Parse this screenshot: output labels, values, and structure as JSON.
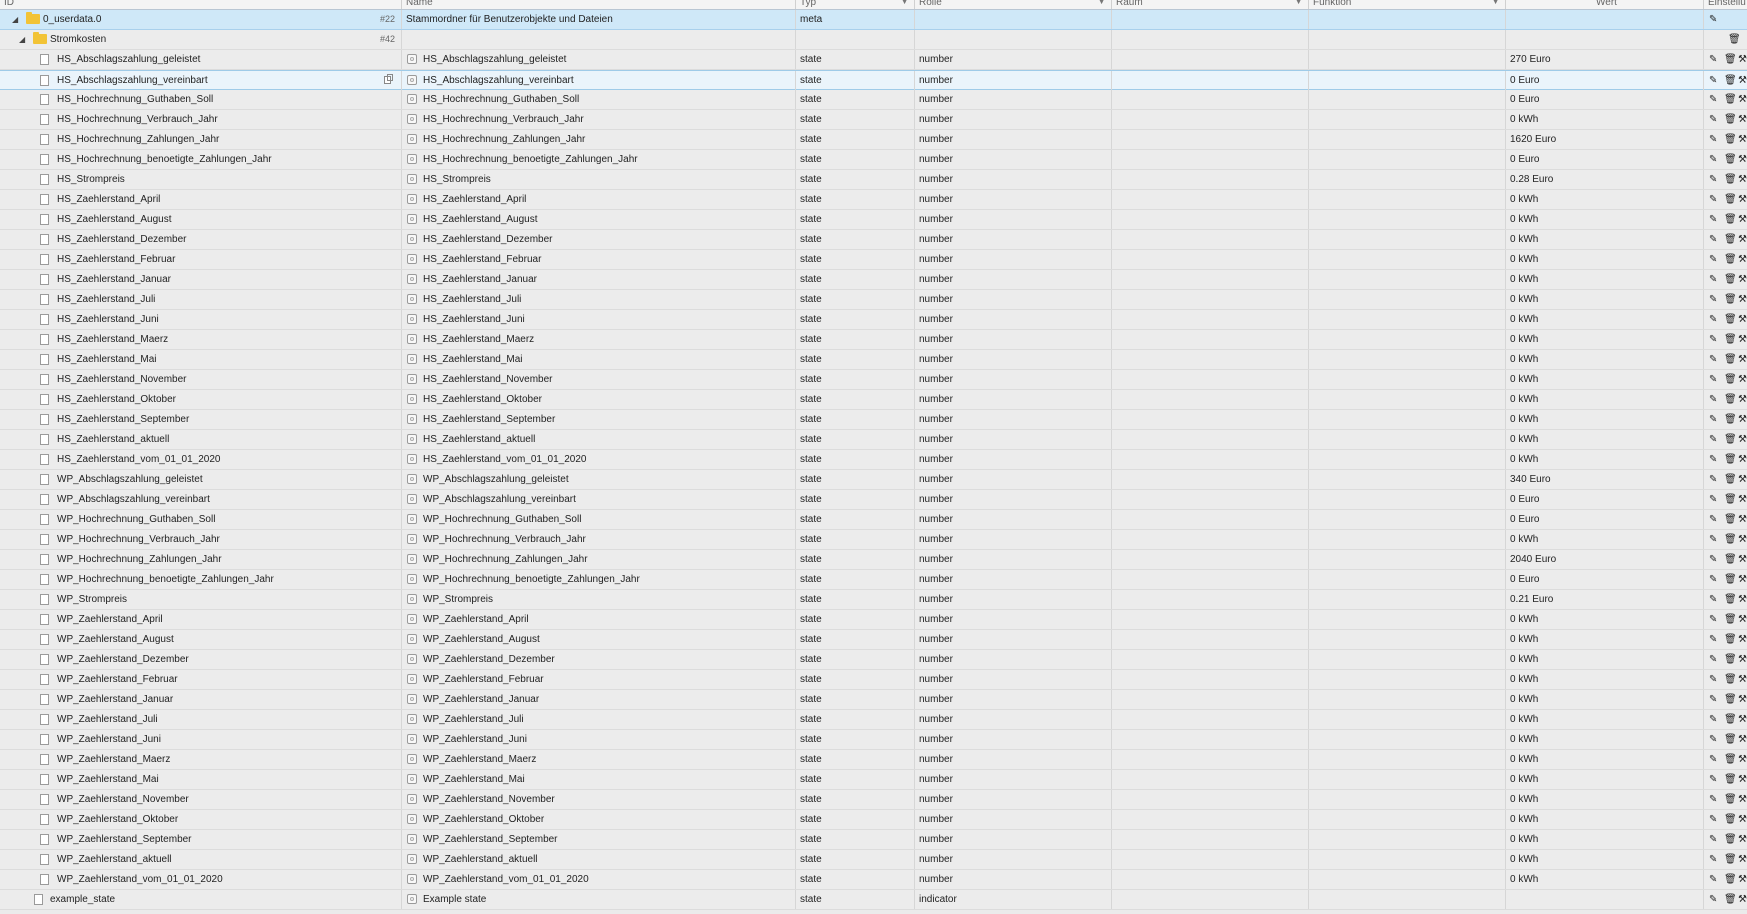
{
  "columns": {
    "id": "ID",
    "name": "Name",
    "typ": "Typ",
    "rolle": "Rolle",
    "raum": "Raum",
    "funktion": "Funktion",
    "wert": "Wert",
    "einstellungen": "Einstellu"
  },
  "root": {
    "id": "0_userdata.0",
    "count": "#22",
    "name": "Stammordner für Benutzerobjekte und Dateien",
    "typ": "meta"
  },
  "folder": {
    "id": "Stromkosten",
    "count": "#42"
  },
  "states": [
    {
      "id": "HS_Abschlagszahlung_geleistet",
      "name": "HS_Abschlagszahlung_geleistet",
      "typ": "state",
      "rolle": "number",
      "wert": "270 Euro"
    },
    {
      "id": "HS_Abschlagszahlung_vereinbart",
      "name": "HS_Abschlagszahlung_vereinbart",
      "typ": "state",
      "rolle": "number",
      "wert": "0 Euro"
    },
    {
      "id": "HS_Hochrechnung_Guthaben_Soll",
      "name": "HS_Hochrechnung_Guthaben_Soll",
      "typ": "state",
      "rolle": "number",
      "wert": "0 Euro"
    },
    {
      "id": "HS_Hochrechnung_Verbrauch_Jahr",
      "name": "HS_Hochrechnung_Verbrauch_Jahr",
      "typ": "state",
      "rolle": "number",
      "wert": "0 kWh"
    },
    {
      "id": "HS_Hochrechnung_Zahlungen_Jahr",
      "name": "HS_Hochrechnung_Zahlungen_Jahr",
      "typ": "state",
      "rolle": "number",
      "wert": "1620 Euro"
    },
    {
      "id": "HS_Hochrechnung_benoetigte_Zahlungen_Jahr",
      "name": "HS_Hochrechnung_benoetigte_Zahlungen_Jahr",
      "typ": "state",
      "rolle": "number",
      "wert": "0 Euro"
    },
    {
      "id": "HS_Strompreis",
      "name": "HS_Strompreis",
      "typ": "state",
      "rolle": "number",
      "wert": "0.28 Euro"
    },
    {
      "id": "HS_Zaehlerstand_April",
      "name": "HS_Zaehlerstand_April",
      "typ": "state",
      "rolle": "number",
      "wert": "0 kWh"
    },
    {
      "id": "HS_Zaehlerstand_August",
      "name": "HS_Zaehlerstand_August",
      "typ": "state",
      "rolle": "number",
      "wert": "0 kWh"
    },
    {
      "id": "HS_Zaehlerstand_Dezember",
      "name": "HS_Zaehlerstand_Dezember",
      "typ": "state",
      "rolle": "number",
      "wert": "0 kWh"
    },
    {
      "id": "HS_Zaehlerstand_Februar",
      "name": "HS_Zaehlerstand_Februar",
      "typ": "state",
      "rolle": "number",
      "wert": "0 kWh"
    },
    {
      "id": "HS_Zaehlerstand_Januar",
      "name": "HS_Zaehlerstand_Januar",
      "typ": "state",
      "rolle": "number",
      "wert": "0 kWh"
    },
    {
      "id": "HS_Zaehlerstand_Juli",
      "name": "HS_Zaehlerstand_Juli",
      "typ": "state",
      "rolle": "number",
      "wert": "0 kWh"
    },
    {
      "id": "HS_Zaehlerstand_Juni",
      "name": "HS_Zaehlerstand_Juni",
      "typ": "state",
      "rolle": "number",
      "wert": "0 kWh"
    },
    {
      "id": "HS_Zaehlerstand_Maerz",
      "name": "HS_Zaehlerstand_Maerz",
      "typ": "state",
      "rolle": "number",
      "wert": "0 kWh"
    },
    {
      "id": "HS_Zaehlerstand_Mai",
      "name": "HS_Zaehlerstand_Mai",
      "typ": "state",
      "rolle": "number",
      "wert": "0 kWh"
    },
    {
      "id": "HS_Zaehlerstand_November",
      "name": "HS_Zaehlerstand_November",
      "typ": "state",
      "rolle": "number",
      "wert": "0 kWh"
    },
    {
      "id": "HS_Zaehlerstand_Oktober",
      "name": "HS_Zaehlerstand_Oktober",
      "typ": "state",
      "rolle": "number",
      "wert": "0 kWh"
    },
    {
      "id": "HS_Zaehlerstand_September",
      "name": "HS_Zaehlerstand_September",
      "typ": "state",
      "rolle": "number",
      "wert": "0 kWh"
    },
    {
      "id": "HS_Zaehlerstand_aktuell",
      "name": "HS_Zaehlerstand_aktuell",
      "typ": "state",
      "rolle": "number",
      "wert": "0 kWh"
    },
    {
      "id": "HS_Zaehlerstand_vom_01_01_2020",
      "name": "HS_Zaehlerstand_vom_01_01_2020",
      "typ": "state",
      "rolle": "number",
      "wert": "0 kWh"
    },
    {
      "id": "WP_Abschlagszahlung_geleistet",
      "name": "WP_Abschlagszahlung_geleistet",
      "typ": "state",
      "rolle": "number",
      "wert": "340 Euro"
    },
    {
      "id": "WP_Abschlagszahlung_vereinbart",
      "name": "WP_Abschlagszahlung_vereinbart",
      "typ": "state",
      "rolle": "number",
      "wert": "0 Euro"
    },
    {
      "id": "WP_Hochrechnung_Guthaben_Soll",
      "name": "WP_Hochrechnung_Guthaben_Soll",
      "typ": "state",
      "rolle": "number",
      "wert": "0 Euro"
    },
    {
      "id": "WP_Hochrechnung_Verbrauch_Jahr",
      "name": "WP_Hochrechnung_Verbrauch_Jahr",
      "typ": "state",
      "rolle": "number",
      "wert": "0 kWh"
    },
    {
      "id": "WP_Hochrechnung_Zahlungen_Jahr",
      "name": "WP_Hochrechnung_Zahlungen_Jahr",
      "typ": "state",
      "rolle": "number",
      "wert": "2040 Euro"
    },
    {
      "id": "WP_Hochrechnung_benoetigte_Zahlungen_Jahr",
      "name": "WP_Hochrechnung_benoetigte_Zahlungen_Jahr",
      "typ": "state",
      "rolle": "number",
      "wert": "0 Euro"
    },
    {
      "id": "WP_Strompreis",
      "name": "WP_Strompreis",
      "typ": "state",
      "rolle": "number",
      "wert": "0.21 Euro"
    },
    {
      "id": "WP_Zaehlerstand_April",
      "name": "WP_Zaehlerstand_April",
      "typ": "state",
      "rolle": "number",
      "wert": "0 kWh"
    },
    {
      "id": "WP_Zaehlerstand_August",
      "name": "WP_Zaehlerstand_August",
      "typ": "state",
      "rolle": "number",
      "wert": "0 kWh"
    },
    {
      "id": "WP_Zaehlerstand_Dezember",
      "name": "WP_Zaehlerstand_Dezember",
      "typ": "state",
      "rolle": "number",
      "wert": "0 kWh"
    },
    {
      "id": "WP_Zaehlerstand_Februar",
      "name": "WP_Zaehlerstand_Februar",
      "typ": "state",
      "rolle": "number",
      "wert": "0 kWh"
    },
    {
      "id": "WP_Zaehlerstand_Januar",
      "name": "WP_Zaehlerstand_Januar",
      "typ": "state",
      "rolle": "number",
      "wert": "0 kWh"
    },
    {
      "id": "WP_Zaehlerstand_Juli",
      "name": "WP_Zaehlerstand_Juli",
      "typ": "state",
      "rolle": "number",
      "wert": "0 kWh"
    },
    {
      "id": "WP_Zaehlerstand_Juni",
      "name": "WP_Zaehlerstand_Juni",
      "typ": "state",
      "rolle": "number",
      "wert": "0 kWh"
    },
    {
      "id": "WP_Zaehlerstand_Maerz",
      "name": "WP_Zaehlerstand_Maerz",
      "typ": "state",
      "rolle": "number",
      "wert": "0 kWh"
    },
    {
      "id": "WP_Zaehlerstand_Mai",
      "name": "WP_Zaehlerstand_Mai",
      "typ": "state",
      "rolle": "number",
      "wert": "0 kWh"
    },
    {
      "id": "WP_Zaehlerstand_November",
      "name": "WP_Zaehlerstand_November",
      "typ": "state",
      "rolle": "number",
      "wert": "0 kWh"
    },
    {
      "id": "WP_Zaehlerstand_Oktober",
      "name": "WP_Zaehlerstand_Oktober",
      "typ": "state",
      "rolle": "number",
      "wert": "0 kWh"
    },
    {
      "id": "WP_Zaehlerstand_September",
      "name": "WP_Zaehlerstand_September",
      "typ": "state",
      "rolle": "number",
      "wert": "0 kWh"
    },
    {
      "id": "WP_Zaehlerstand_aktuell",
      "name": "WP_Zaehlerstand_aktuell",
      "typ": "state",
      "rolle": "number",
      "wert": "0 kWh"
    },
    {
      "id": "WP_Zaehlerstand_vom_01_01_2020",
      "name": "WP_Zaehlerstand_vom_01_01_2020",
      "typ": "state",
      "rolle": "number",
      "wert": "0 kWh"
    }
  ],
  "example": {
    "id": "example_state",
    "name": "Example state",
    "typ": "state",
    "rolle": "indicator"
  },
  "selected_index": 1,
  "icons": {
    "edit": "pencil-icon",
    "delete": "trash-icon",
    "more": "wrench-icon",
    "expand": "triangle-down-icon",
    "folder": "folder-icon",
    "state": "document-icon",
    "copy": "copy-icon"
  }
}
